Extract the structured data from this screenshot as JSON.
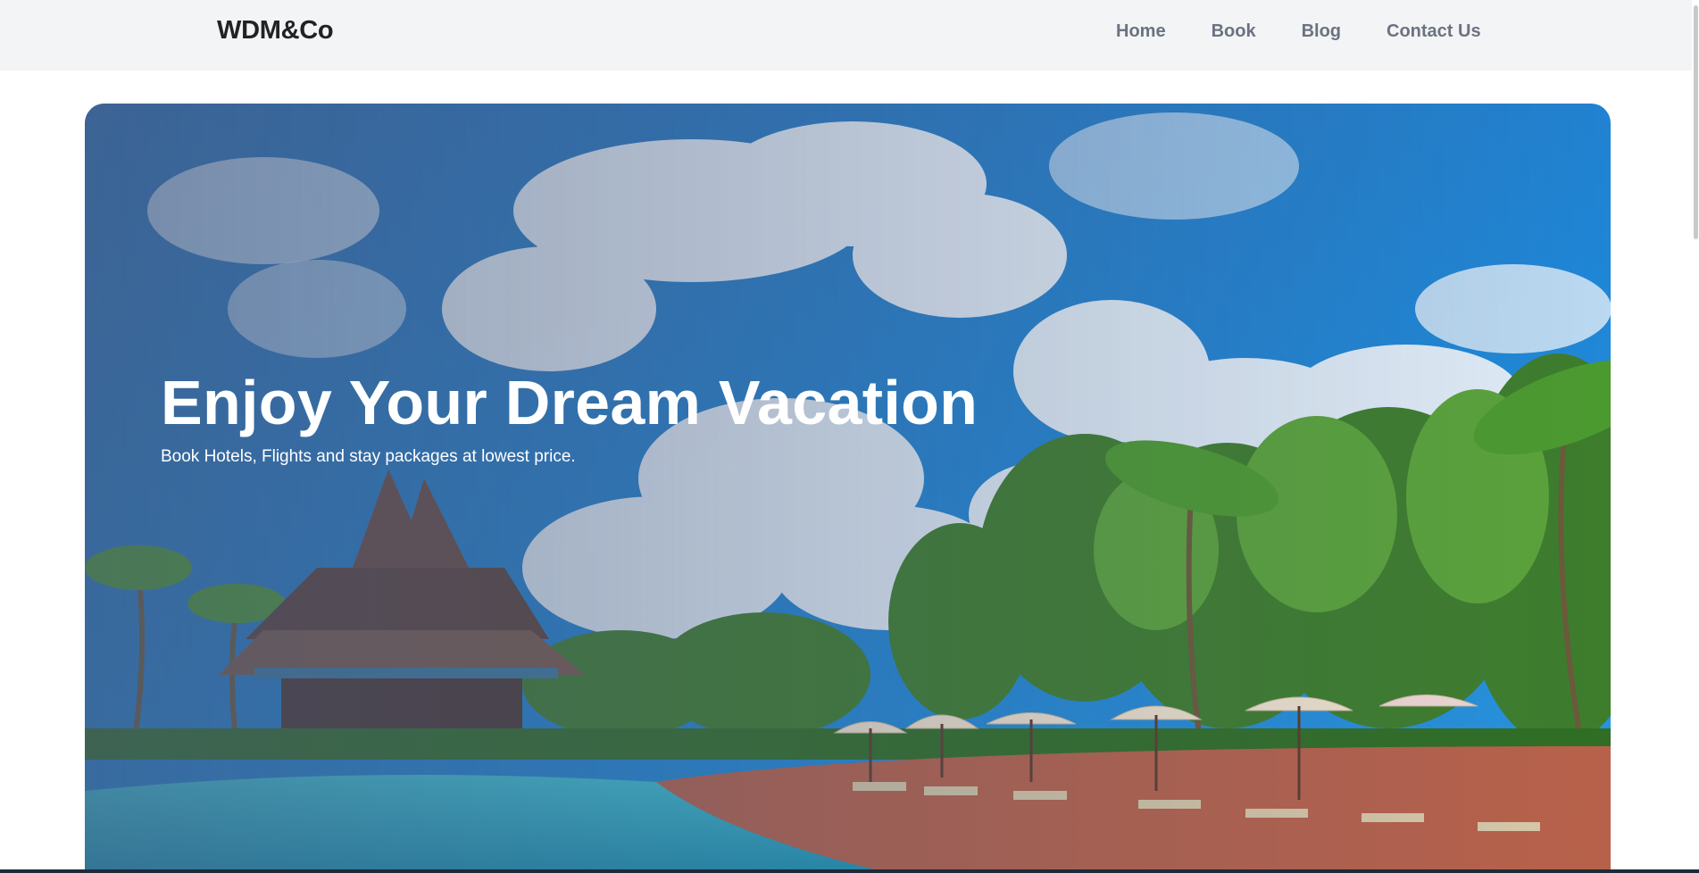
{
  "header": {
    "brand": "WDM&Co",
    "nav": [
      {
        "label": "Home"
      },
      {
        "label": "Book"
      },
      {
        "label": "Blog"
      },
      {
        "label": "Contact Us"
      }
    ]
  },
  "hero": {
    "title": "Enjoy Your Dream Vacation",
    "subtitle": "Book Hotels, Flights and stay packages at lowest price.",
    "image": "tropical-resort-pool-photo"
  },
  "colors": {
    "header_bg": "#f3f4f6",
    "nav_text": "#6b7280",
    "brand_text": "#222222",
    "sky": "#1f7fcf",
    "water": "#2bb3c9",
    "foliage": "#3f8f2f"
  }
}
